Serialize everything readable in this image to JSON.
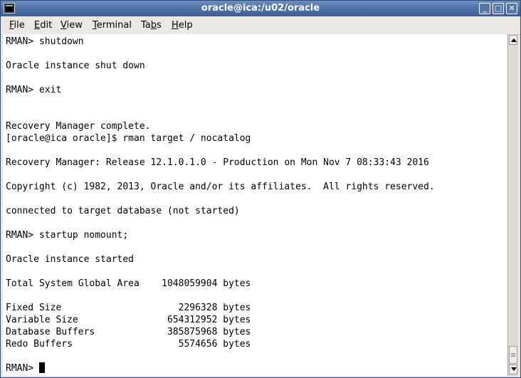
{
  "window": {
    "title": "oracle@ica:/u02/oracle",
    "buttons": {
      "minimize": "_",
      "maximize": "□",
      "close": "✕"
    }
  },
  "menu": [
    {
      "label": "File"
    },
    {
      "label": "Edit"
    },
    {
      "label": "View"
    },
    {
      "label": "Terminal"
    },
    {
      "label": "Tabs"
    },
    {
      "label": "Help"
    }
  ],
  "terminal": {
    "lines": [
      "RMAN> shutdown",
      "",
      "Oracle instance shut down",
      "",
      "RMAN> exit",
      "",
      "",
      "Recovery Manager complete.",
      "[oracle@ica oracle]$ rman target / nocatalog",
      "",
      "Recovery Manager: Release 12.1.0.1.0 - Production on Mon Nov 7 08:33:43 2016",
      "",
      "Copyright (c) 1982, 2013, Oracle and/or its affiliates.  All rights reserved.",
      "",
      "connected to target database (not started)",
      "",
      "RMAN> startup nomount;",
      "",
      "Oracle instance started",
      "",
      "Total System Global Area    1048059904 bytes",
      "",
      "Fixed Size                     2296328 bytes",
      "Variable Size                654312952 bytes",
      "Database Buffers             385875968 bytes",
      "Redo Buffers                   5574656 bytes",
      "",
      "RMAN> "
    ]
  },
  "icons": {
    "app": "terminal-icon",
    "scroll_up": "arrow-up-icon",
    "scroll_down": "arrow-down-icon"
  }
}
